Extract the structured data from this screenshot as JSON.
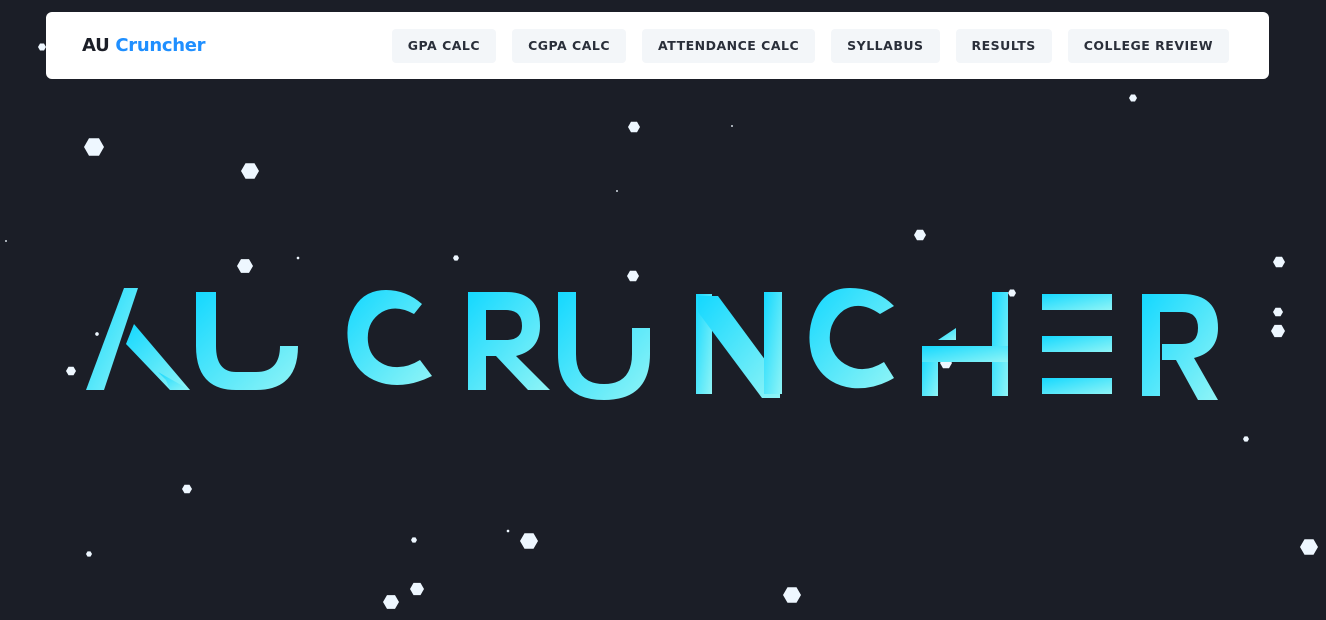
{
  "header": {
    "brand_prefix": "AU",
    "brand_accent": "Cruncher",
    "nav": [
      {
        "label": "GPA CALC"
      },
      {
        "label": "CGPA CALC"
      },
      {
        "label": "ATTENDANCE CALC"
      },
      {
        "label": "SYLLABUS"
      },
      {
        "label": "RESULTS"
      },
      {
        "label": "COLLEGE REVIEW"
      }
    ]
  },
  "hero": {
    "logotype": "AU CRUNCHER"
  },
  "colors": {
    "background": "#1b1e27",
    "accent": "#1f8fff",
    "logo_gradient_start": "#14d8ff",
    "logo_gradient_end": "#8ff4f6",
    "particle": "#eef7ff"
  },
  "decor": {
    "particle_icon": "hexagon-particle-icon"
  }
}
